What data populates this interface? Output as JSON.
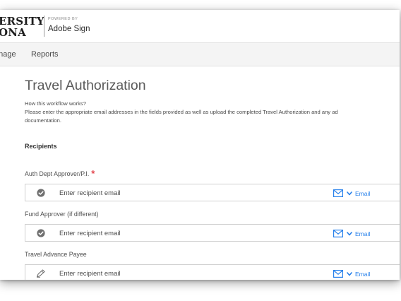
{
  "header": {
    "logo_line1": "ERSITY",
    "logo_line2": "ONA",
    "powered_by": "POWERED BY",
    "product": "Adobe Sign"
  },
  "nav": {
    "items": [
      {
        "label": "anage"
      },
      {
        "label": "Reports"
      }
    ]
  },
  "page": {
    "title": "Travel Authorization",
    "description_lines": [
      "How this workflow works?",
      "Please enter the appropriate email addresses in the fields provided as well as upload the completed Travel Authorization and any ad",
      "documentation."
    ],
    "section_title": "Recipients"
  },
  "recipients": [
    {
      "label": "Auth Dept Approver/P.I.",
      "required_mark": "*",
      "placeholder": "Enter recipient email",
      "method": "Email",
      "icon": "check-circle-icon"
    },
    {
      "label": "Fund Approver (if different)",
      "required_mark": "",
      "placeholder": "Enter recipient email",
      "method": "Email",
      "icon": "check-circle-icon"
    },
    {
      "label": "Travel Advance Payee",
      "required_mark": "",
      "placeholder": "Enter recipient email",
      "method": "Email",
      "icon": "pen-icon"
    }
  ],
  "colors": {
    "accent": "#2680eb",
    "required": "#e34850"
  }
}
